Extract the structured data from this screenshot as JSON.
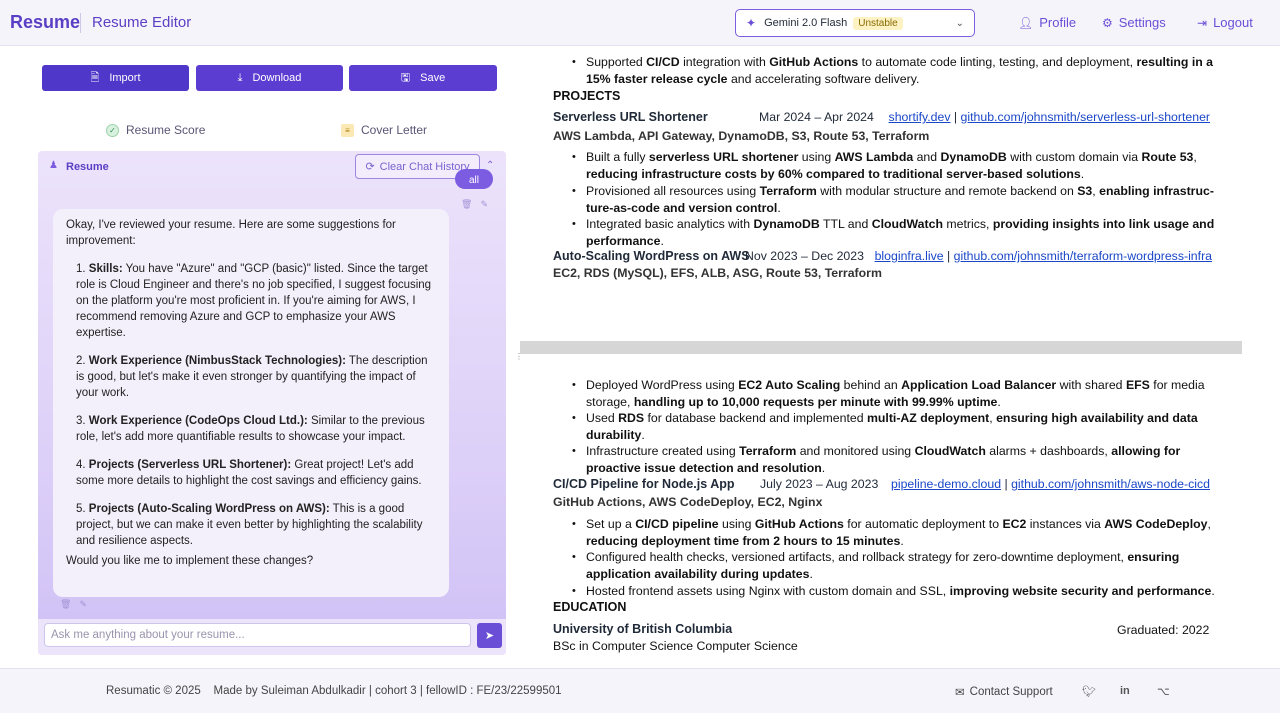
{
  "header": {
    "brand": "Resume",
    "title": "Resume Editor",
    "model": {
      "name": "Gemini 2.0 Flash",
      "badge": "Unstable"
    },
    "nav": {
      "profile": "Profile",
      "settings": "Settings",
      "logout": "Logout"
    }
  },
  "toolbar": {
    "import": "Import",
    "download": "Download",
    "save": "Save"
  },
  "tabs": {
    "score": "Resume Score",
    "cover": "Cover Letter"
  },
  "chat": {
    "label": "Resume",
    "clear": "Clear Chat History",
    "user_msg": "all",
    "intro": "Okay, I've reviewed your resume. Here are some suggestions for improvement:",
    "items": [
      {
        "num": "1.",
        "title": "Skills:",
        "text": " You have \"Azure\" and \"GCP (basic)\" listed. Since the target role is Cloud Engineer and there's no job specified, I suggest focusing on the platform you're most proficient in. If you're aiming for AWS, I recommend removing Azure and GCP to emphasize your AWS expertise."
      },
      {
        "num": "2.",
        "title": "Work Experience (NimbusStack Technologies):",
        "text": " The description is good, but let's make it even stronger by quantifying the impact of your work."
      },
      {
        "num": "3.",
        "title": "Work Experience (CodeOps Cloud Ltd.):",
        "text": " Similar to the previous role, let's add more quantifiable results to showcase your impact."
      },
      {
        "num": "4.",
        "title": "Projects (Serverless URL Shortener):",
        "text": " Great project! Let's add some more details to highlight the cost savings and efficiency gains."
      },
      {
        "num": "5.",
        "title": "Projects (Auto-Scaling WordPress on AWS):",
        "text": " This is a good project, but we can make it even better by highlighting the scalability and resilience aspects."
      }
    ],
    "outro": "Would you like me to implement these changes?",
    "placeholder": "Ask me anything about your resume..."
  },
  "resume": {
    "top_bullet": [
      "Supported ",
      "CI/CD",
      " integration with ",
      "GitHub Actions",
      " to automate code linting, testing, and deployment, ",
      "resulting in a 15% faster release cycle",
      " and accelerating software delivery."
    ],
    "projects_heading": "PROJECTS",
    "p1": {
      "title": "Serverless URL Shortener",
      "date": "Mar 2024 – Apr 2024",
      "link1": "shortify.dev",
      "link2": "github.com/johnsmith/serverless-url-shortener",
      "tech": "AWS Lambda, API Gateway, DynamoDB, S3, Route 53, Terraform",
      "b1": [
        "Built a fully ",
        "serverless URL shortener",
        " using ",
        "AWS Lambda",
        " and ",
        "DynamoDB",
        " with custom domain via ",
        "Route 53",
        ", ",
        "reducing infrastructure costs by 60% compared to traditional server-based solutions",
        "."
      ],
      "b2": [
        "Provisioned all resources using ",
        "Terraform",
        " with modular structure and remote backend on ",
        "S3",
        ", ",
        "enabling infrastruc-ture-as-code and version control",
        "."
      ],
      "b3": [
        "Integrated basic analytics with ",
        "DynamoDB",
        " TTL and ",
        "CloudWatch",
        " metrics, ",
        "providing insights into link usage and performance",
        "."
      ]
    },
    "p2": {
      "title": "Auto-Scaling WordPress on AWS",
      "date": "Nov 2023 – Dec 2023",
      "link1": "bloginfra.live",
      "link2": "github.com/johnsmith/terraform-wordpress-infra",
      "tech": "EC2, RDS (MySQL), EFS, ALB, ASG, Route 53, Terraform",
      "b1": [
        "Deployed WordPress using ",
        "EC2 Auto Scaling",
        " behind an ",
        "Application Load Balancer",
        " with shared ",
        "EFS",
        " for media storage, ",
        "handling up to 10,000 requests per minute with 99.99% uptime",
        "."
      ],
      "b2": [
        "Used ",
        "RDS",
        " for database backend and implemented ",
        "multi-AZ deployment",
        ", ",
        "ensuring high availability and data durability",
        "."
      ],
      "b3": [
        "Infrastructure created using ",
        "Terraform",
        " and monitored using ",
        "CloudWatch",
        " alarms + dashboards, ",
        "allowing for proactive issue detection and resolution",
        "."
      ]
    },
    "p3": {
      "title": "CI/CD Pipeline for Node.js App",
      "date": "July 2023 – Aug 2023",
      "link1": "pipeline-demo.cloud",
      "link2": "github.com/johnsmith/aws-node-cicd",
      "tech": "GitHub Actions, AWS CodeDeploy, EC2, Nginx",
      "b1": [
        "Set up a ",
        "CI/CD pipeline",
        " using ",
        "GitHub Actions",
        " for automatic deployment to ",
        "EC2",
        " instances via ",
        "AWS CodeDeploy",
        ", ",
        "reducing deployment time from 2 hours to 15 minutes",
        "."
      ],
      "b2": [
        "Configured health checks, versioned artifacts, and rollback strategy for zero-downtime deployment, ",
        "ensuring application availability during updates",
        "."
      ],
      "b3": [
        "Hosted frontend assets using Nginx with custom domain and SSL, ",
        "improving website security and performance",
        "."
      ]
    },
    "education_heading": "EDUCATION",
    "school": "University of British Columbia",
    "graduated": "Graduated: 2022",
    "degree": "BSc in Computer Science Computer Science"
  },
  "footer": {
    "credits": "Resumatic © 2025    Made by Suleiman Abdulkadir | cohort 3 | fellowID : FE/23/22599501",
    "support": "Contact Support"
  },
  "colors": {
    "accent": "#5b3dd1",
    "link": "#1a47c8"
  }
}
